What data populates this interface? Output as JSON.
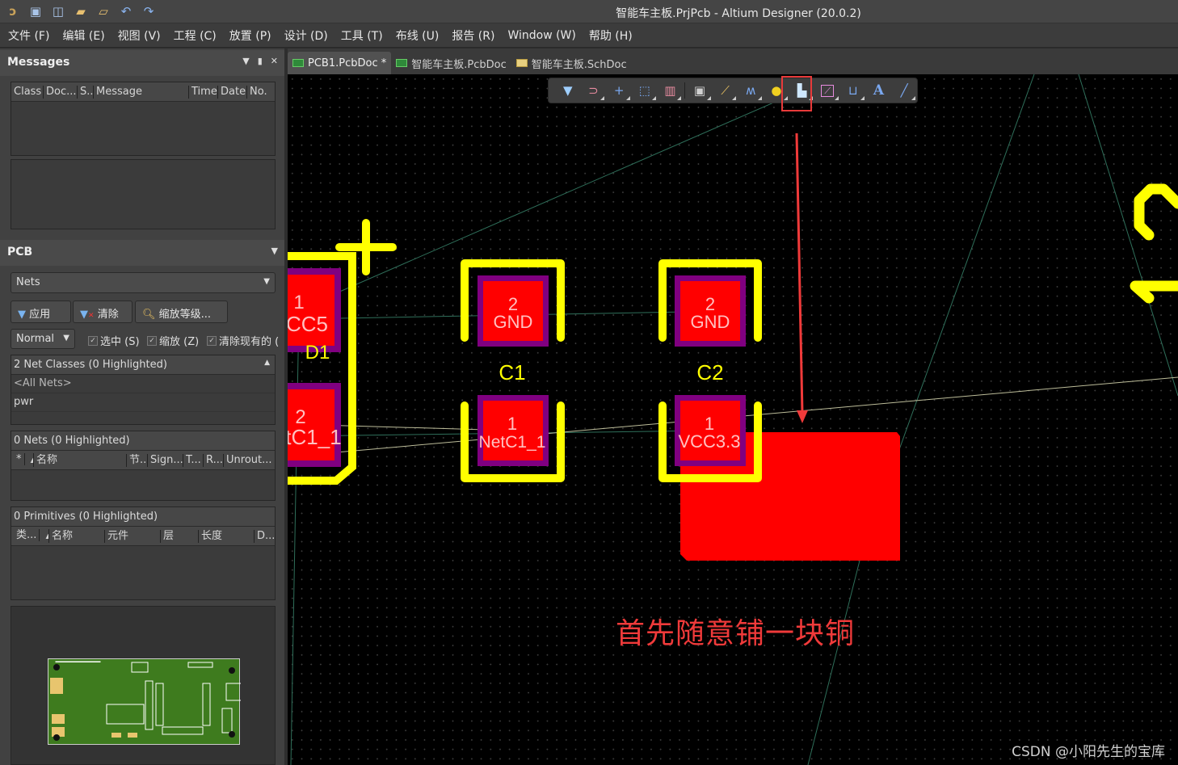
{
  "window": {
    "title": "智能车主板.PrjPcb - Altium Designer (20.0.2)",
    "quick_access": [
      "app-logo-icon",
      "save-icon",
      "save-all-icon",
      "open-icon",
      "open-project-icon",
      "undo-icon",
      "redo-icon"
    ]
  },
  "menu": [
    "文件 (F)",
    "编辑 (E)",
    "视图 (V)",
    "工程 (C)",
    "放置 (P)",
    "设计 (D)",
    "工具 (T)",
    "布线 (U)",
    "报告 (R)",
    "Window (W)",
    "帮助 (H)"
  ],
  "messages_panel": {
    "title": "Messages",
    "columns": [
      "Class",
      "Doc...",
      "S...",
      "Message",
      "Time",
      "Date",
      "No."
    ]
  },
  "pcb_panel": {
    "title": "PCB",
    "mode_select": "Nets",
    "buttons": {
      "apply": "应用",
      "clear": "清除",
      "zoom_level": "缩放等级..."
    },
    "mask_select": "Normal",
    "checkboxes": [
      {
        "label": "选中 (S)",
        "checked": true
      },
      {
        "label": "缩放 (Z)",
        "checked": true
      },
      {
        "label": "清除现有的 (",
        "checked": true
      }
    ],
    "net_classes": {
      "title": "2 Net Classes (0 Highlighted)",
      "items": [
        "<All Nets>",
        "pwr"
      ]
    },
    "nets": {
      "title": "0 Nets (0 Highlighted)",
      "columns": [
        "*",
        "名称",
        "节..",
        "Sign...",
        "T...",
        "R...",
        "Unrout..."
      ]
    },
    "primitives": {
      "title": "0 Primitives (0 Highlighted)",
      "columns": [
        "类...",
        "名称",
        "元件",
        "层",
        "长度",
        "D..."
      ]
    }
  },
  "tabs": [
    {
      "label": "PCB1.PcbDoc *",
      "type": "pcb",
      "active": true
    },
    {
      "label": "智能车主板.PcbDoc",
      "type": "pcb",
      "active": false
    },
    {
      "label": "智能车主板.SchDoc",
      "type": "sch",
      "active": false
    }
  ],
  "active_bar": [
    {
      "name": "filter-icon",
      "glyph": "▼"
    },
    {
      "name": "snap-magnet-icon",
      "glyph": "⊃"
    },
    {
      "name": "move-cross-icon",
      "glyph": "+"
    },
    {
      "name": "select-rect-icon",
      "glyph": "⬚"
    },
    {
      "name": "align-icon",
      "glyph": "▥"
    },
    {
      "name": "component-icon",
      "glyph": "▣"
    },
    {
      "name": "interactive-route-icon",
      "glyph": "⟋"
    },
    {
      "name": "diff-pair-icon",
      "glyph": "ʍ"
    },
    {
      "name": "via-icon",
      "glyph": "●"
    },
    {
      "name": "fill-region-icon",
      "glyph": "▙"
    },
    {
      "name": "keepout-icon",
      "glyph": "⟋"
    },
    {
      "name": "dimension-icon",
      "glyph": "⊔"
    },
    {
      "name": "string-text-icon",
      "glyph": "A"
    },
    {
      "name": "line-icon",
      "glyph": "╱"
    }
  ],
  "pcb": {
    "components": [
      {
        "ref": "D1",
        "pads": [
          {
            "num": "1",
            "net": "CC5"
          },
          {
            "num": "2",
            "net": "tC1_1"
          }
        ]
      },
      {
        "ref": "C1",
        "pads": [
          {
            "num": "2",
            "net": "GND"
          },
          {
            "num": "1",
            "net": "NetC1_1"
          }
        ]
      },
      {
        "ref": "C2",
        "pads": [
          {
            "num": "2",
            "net": "GND"
          },
          {
            "num": "1",
            "net": "VCC3.3"
          }
        ]
      }
    ],
    "colors": {
      "pad": "#ff0000",
      "pad_border": "#800080",
      "silk": "#ffff00",
      "ratsnest": "#2f6f5a",
      "fill": "#ff0000"
    }
  },
  "annotation": "首先随意铺一块铜",
  "watermark": "CSDN @小阳先生的宝库"
}
